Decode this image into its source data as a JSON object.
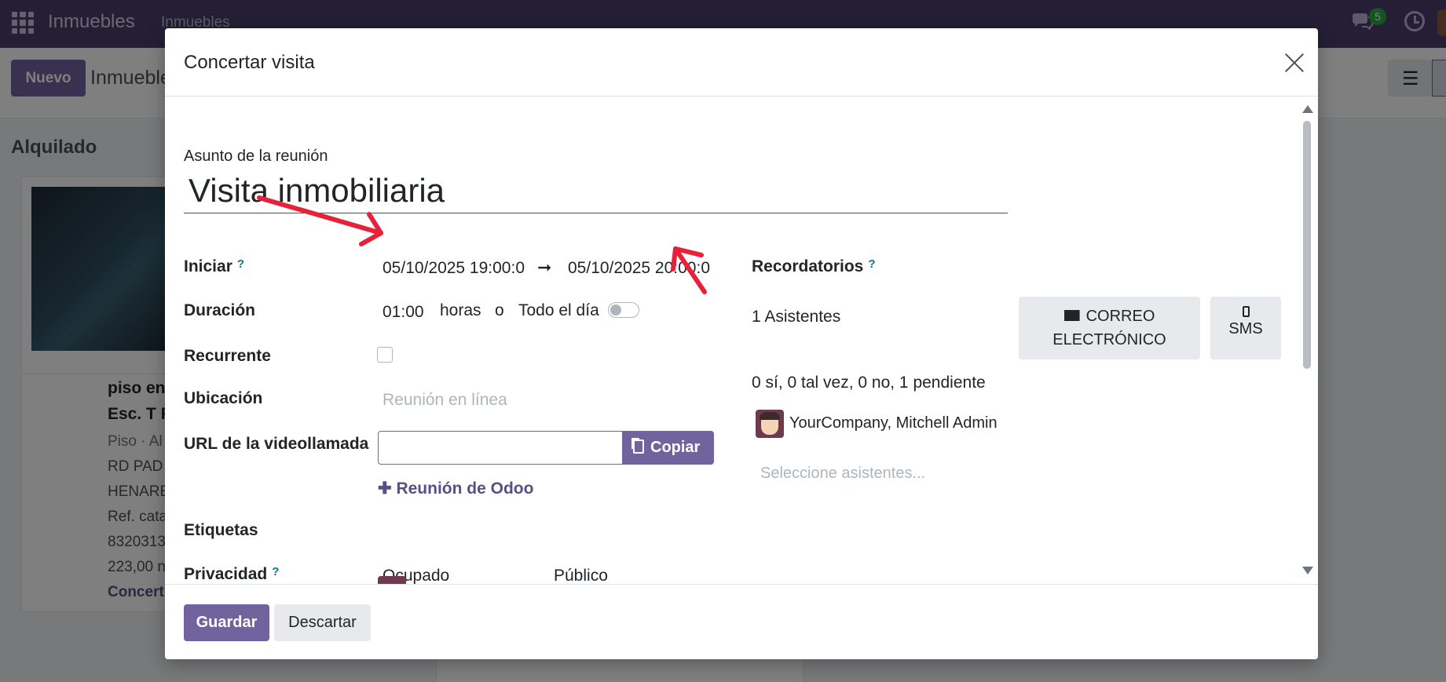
{
  "topbar": {
    "brand": "Inmuebles",
    "menu_item": "Inmuebles",
    "chat_badge": "5"
  },
  "controlbar": {
    "new_label": "Nuevo",
    "breadcrumb": "Inmuebles"
  },
  "kanban": {
    "column_title": "Alquilado",
    "card": {
      "line1": "piso en",
      "line2": "Esc. T P",
      "line3": "Piso · Al",
      "line4": "RD PAD",
      "line5": "HENARE",
      "line6": "Ref. cata",
      "line7": "8320313",
      "line8": "223,00 n",
      "line9": "Concert"
    }
  },
  "modal": {
    "title": "Concertar visita",
    "subject_label": "Asunto de la reunión",
    "subject_value": "Visita inmobiliaria",
    "start_label": "Iniciar",
    "start_value": "05/10/2025 19:00:0",
    "end_value": "05/10/2025 20:00:0",
    "duration_label": "Duración",
    "duration_value": "01:00",
    "duration_unit": "horas",
    "or_text": "o",
    "all_day_label": "Todo el día",
    "recurrent_label": "Recurrente",
    "location_label": "Ubicación",
    "location_placeholder": "Reunión en línea",
    "video_url_label": "URL de la videollamada",
    "copy_label": "Copiar",
    "odoo_meeting_label": "Reunión de Odoo",
    "tags_label": "Etiquetas",
    "privacy_label": "Privacidad",
    "privacy_busy": "Ocupado",
    "privacy_public": "Público",
    "reminders_label": "Recordatorios",
    "attendees_count": "1 Asistentes",
    "email_label_1": "CORREO",
    "email_label_2": "ELECTRÓNICO",
    "sms_label": "SMS",
    "attendance_summary": "0 sí, 0 tal vez, 0 no, 1 pendiente",
    "attendee_name": "YourCompany, Mitchell Admin",
    "attendee_placeholder": "Seleccione asistentes...",
    "help_mark": "?",
    "save_label": "Guardar",
    "discard_label": "Descartar"
  },
  "colors": {
    "primary": "#71639e",
    "topbar": "#4b3f6b",
    "annotation_arrow": "#e8213a"
  }
}
